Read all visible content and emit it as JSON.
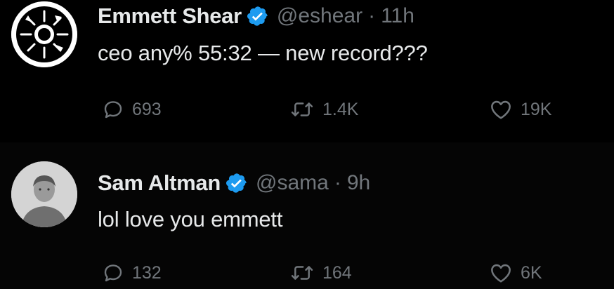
{
  "tweets": [
    {
      "name": "Emmett Shear",
      "handle": "@eshear",
      "separator": "·",
      "time": "11h",
      "text": "ceo any% 55:32 — new record???",
      "avatar_icon": "abstract-sun-logo-icon",
      "replies": "693",
      "retweets": "1.4K",
      "likes": "19K"
    },
    {
      "name": "Sam Altman",
      "handle": "@sama",
      "separator": "·",
      "time": "9h",
      "text": "lol love you emmett",
      "avatar_icon": "profile-photo",
      "replies": "132",
      "retweets": "164",
      "likes": "6K"
    }
  ],
  "colors": {
    "background": "#000000",
    "primary_text": "#e7e9ea",
    "secondary_text": "#71767b",
    "verified_badge": "#1d9bf0",
    "thread_line": "#3e4144"
  },
  "icons": {
    "verified": "verified-badge-icon",
    "reply": "reply-bubble-icon",
    "retweet": "retweet-icon",
    "like": "heart-icon"
  }
}
